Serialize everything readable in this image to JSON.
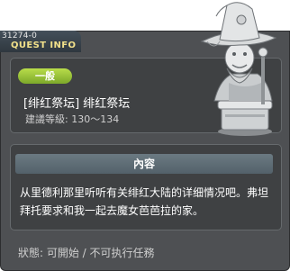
{
  "header": {
    "quest_id": "31274-0",
    "title": "QUEST INFO"
  },
  "quest": {
    "badge": "一般",
    "name": "[绯红祭坛] 绯红祭坛",
    "level": "建議等級: 130～134"
  },
  "content": {
    "header": "內容",
    "text": "从里德利那里听听有关绯红大陆的详细情况吧。弗坦拜托要求和我一起去魔女芭芭拉的家。"
  },
  "status": {
    "text": "狀態: 可開始 / 不可执行任務"
  },
  "colors": {
    "window_bg": "#4e5053",
    "panel_bg": "#3f4143",
    "badge_green": "#9cc93a",
    "title_yellow": "#f1e08a"
  },
  "icons": {
    "portrait": "witch-statue-npc"
  }
}
